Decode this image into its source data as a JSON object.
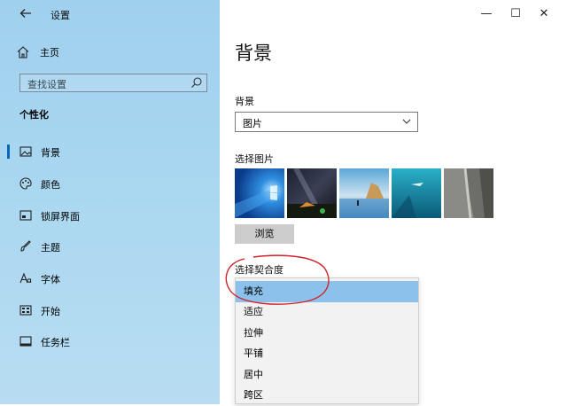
{
  "window": {
    "app_title": "设置",
    "controls": {
      "minimize": "—",
      "maximize": "☐",
      "close": "✕"
    }
  },
  "sidebar": {
    "home_label": "主页",
    "search_placeholder": "查找设置",
    "section_title": "个性化",
    "items": [
      {
        "label": "背景",
        "icon": "picture-icon",
        "active": true
      },
      {
        "label": "颜色",
        "icon": "palette-icon",
        "active": false
      },
      {
        "label": "锁屏界面",
        "icon": "lock-screen-icon",
        "active": false
      },
      {
        "label": "主题",
        "icon": "brush-icon",
        "active": false
      },
      {
        "label": "字体",
        "icon": "font-icon",
        "active": false
      },
      {
        "label": "开始",
        "icon": "start-icon",
        "active": false
      },
      {
        "label": "任务栏",
        "icon": "taskbar-icon",
        "active": false
      }
    ]
  },
  "main": {
    "page_title": "背景",
    "background_label": "背景",
    "background_value": "图片",
    "choose_picture_label": "选择图片",
    "browse_button": "浏览",
    "choose_fit_label": "选择契合度",
    "fit_options": [
      "填充",
      "适应",
      "拉伸",
      "平铺",
      "居中",
      "跨区"
    ],
    "fit_selected": "填充"
  },
  "colors": {
    "accent": "#0a66b6",
    "selected_option": "#8cc1ec",
    "annotation": "#d2232a"
  }
}
